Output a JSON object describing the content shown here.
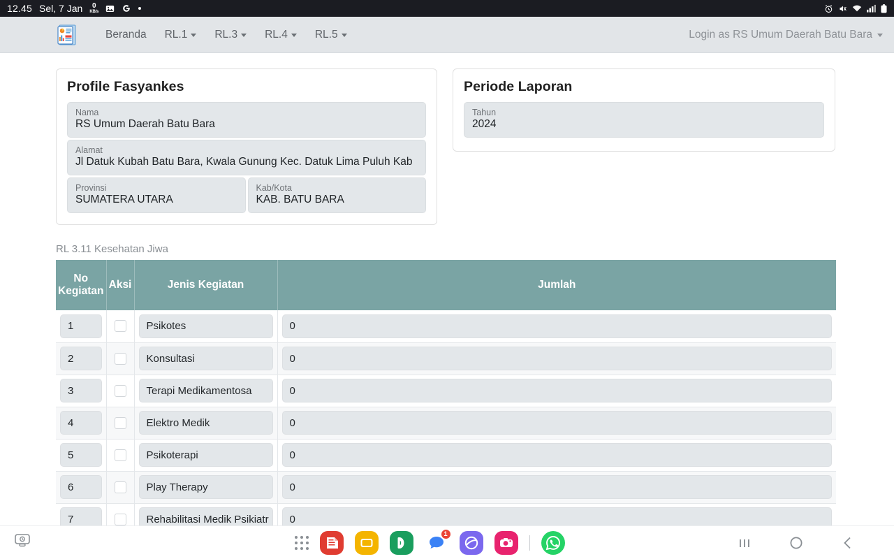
{
  "statusbar": {
    "time": "12.45",
    "date": "Sel, 7 Jan",
    "net_speed_value": "0",
    "net_speed_unit": "KB/s",
    "icons_left": [
      "gallery-icon",
      "google-icon",
      "dot-icon"
    ],
    "icons_right": [
      "alarm-icon",
      "mute-icon",
      "wifi-icon",
      "signal-icon",
      "battery-icon"
    ]
  },
  "navbar": {
    "logo": "report-logo-icon",
    "links": [
      {
        "label": "Beranda",
        "has_caret": false
      },
      {
        "label": "RL.1",
        "has_caret": true
      },
      {
        "label": "RL.3",
        "has_caret": true
      },
      {
        "label": "RL.4",
        "has_caret": true
      },
      {
        "label": "RL.5",
        "has_caret": true
      }
    ],
    "user_label": "Login as RS Umum Daerah Batu Bara"
  },
  "profile_card": {
    "title": "Profile Fasyankes",
    "nama": {
      "label": "Nama",
      "value": "RS Umum Daerah Batu Bara"
    },
    "alamat": {
      "label": "Alamat",
      "value": "Jl Datuk Kubah Batu Bara, Kwala  Gunung Kec. Datuk Lima Puluh Kab"
    },
    "provinsi": {
      "label": "Provinsi",
      "value": "SUMATERA UTARA"
    },
    "kabkota": {
      "label": "Kab/Kota",
      "value": "KAB. BATU BARA"
    }
  },
  "periode_card": {
    "title": "Periode Laporan",
    "tahun": {
      "label": "Tahun",
      "value": "2024"
    }
  },
  "table": {
    "caption": "RL 3.11 Kesehatan Jiwa",
    "header_color": "#7aa4a4",
    "columns": [
      "No Kegiatan",
      "Aksi",
      "Jenis Kegiatan",
      "Jumlah"
    ],
    "rows": [
      {
        "no": "1",
        "jenis": "Psikotes",
        "jumlah": "0"
      },
      {
        "no": "2",
        "jenis": "Konsultasi",
        "jumlah": "0"
      },
      {
        "no": "3",
        "jenis": "Terapi Medikamentosa",
        "jumlah": "0"
      },
      {
        "no": "4",
        "jenis": "Elektro Medik",
        "jumlah": "0"
      },
      {
        "no": "5",
        "jenis": "Psikoterapi",
        "jumlah": "0"
      },
      {
        "no": "6",
        "jenis": "Play Therapy",
        "jumlah": "0"
      },
      {
        "no": "7",
        "jenis": "Rehabilitasi Medik Psikiatr",
        "jumlah": "0"
      }
    ]
  },
  "taskbar": {
    "left_icon": "screen-clock-icon",
    "app_drawer": "app-drawer-icon",
    "apps": [
      {
        "name": "notes-app-icon",
        "color": "#e03c31"
      },
      {
        "name": "files-app-icon",
        "color": "#f4b400"
      },
      {
        "name": "phone-app-icon",
        "color": "#1a9e5e"
      },
      {
        "name": "messages-app-icon",
        "color": "#ffffff",
        "badge": "1"
      },
      {
        "name": "internet-app-icon",
        "color": "#7b68ee"
      },
      {
        "name": "camera-app-icon",
        "color": "#e8236e"
      },
      {
        "name": "whatsapp-app-icon",
        "color": "#25d366"
      }
    ],
    "nav": [
      "recents-button",
      "home-button",
      "back-button"
    ]
  }
}
